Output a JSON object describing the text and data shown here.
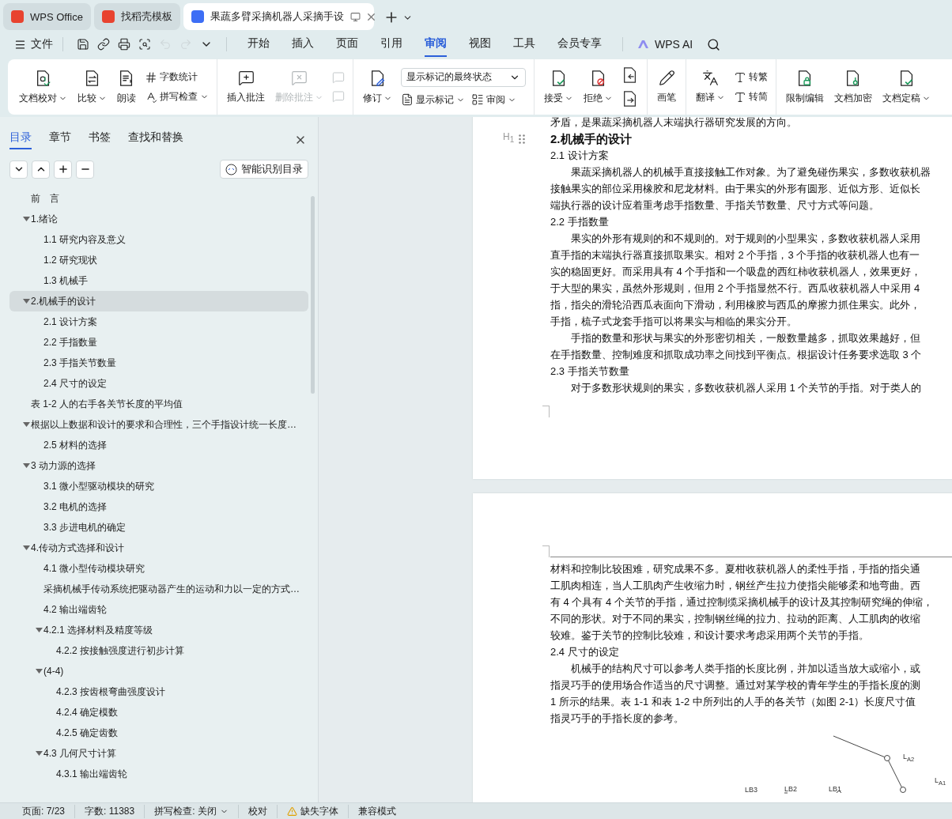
{
  "browser_tabs": [
    {
      "label": "WPS Office",
      "selected": false
    },
    {
      "label": "找稻壳模板",
      "selected": false
    },
    {
      "label": "果蔬多臂采摘机器人采摘手设",
      "selected": true
    }
  ],
  "menu": {
    "file": "文件",
    "quick_tools": [
      {
        "disabled": false
      },
      {
        "disabled": false
      },
      {
        "disabled": false
      },
      {
        "disabled": false
      },
      {
        "disabled": true
      },
      {
        "disabled": true
      }
    ],
    "tabs": [
      {
        "label": "开始",
        "selected": false
      },
      {
        "label": "插入",
        "selected": false
      },
      {
        "label": "页面",
        "selected": false
      },
      {
        "label": "引用",
        "selected": false
      },
      {
        "label": "审阅",
        "selected": true
      },
      {
        "label": "视图",
        "selected": false
      },
      {
        "label": "工具",
        "selected": false
      },
      {
        "label": "会员专享",
        "selected": false
      }
    ],
    "ai": "WPS AI"
  },
  "ribbon": {
    "groups": [
      {
        "columns": [
          {
            "rows": [
              [
                {
                  "kind": "large",
                  "label": "文档校对",
                  "menu": true,
                  "disabled": false
                }
              ]
            ]
          },
          {
            "rows": [
              [
                {
                  "kind": "large",
                  "label": "比较",
                  "menu": true,
                  "disabled": false
                }
              ]
            ]
          },
          {
            "rows": [
              [
                {
                  "kind": "large",
                  "label": "朗读",
                  "menu": false,
                  "disabled": false
                }
              ]
            ]
          },
          {
            "rows": [
              [
                {
                  "kind": "small",
                  "label": "字数统计",
                  "menu": false,
                  "disabled": false
                }
              ],
              [
                {
                  "kind": "small",
                  "label": "拼写检查",
                  "menu": true,
                  "disabled": false
                }
              ]
            ]
          }
        ]
      },
      {
        "columns": [
          {
            "rows": [
              [
                {
                  "kind": "large",
                  "label": "插入批注",
                  "menu": false,
                  "disabled": false
                }
              ]
            ]
          },
          {
            "rows": [
              [
                {
                  "kind": "large",
                  "label": "删除批注",
                  "menu": true,
                  "disabled": true
                }
              ]
            ]
          },
          {
            "rows": [
              [
                {
                  "kind": "icon",
                  "disabled": true
                }
              ],
              [
                {
                  "kind": "icon",
                  "disabled": true
                }
              ]
            ]
          }
        ]
      },
      {
        "columns": [
          {
            "rows": [
              [
                {
                  "kind": "large",
                  "label": "修订",
                  "menu": true,
                  "disabled": false
                }
              ]
            ]
          },
          {
            "rows": [
              [
                {
                  "kind": "select",
                  "label": "显示标记的最终状态",
                  "menu": true,
                  "disabled": false
                }
              ],
              [
                {
                  "kind": "small",
                  "label": "显示标记",
                  "menu": true,
                  "disabled": false
                },
                {
                  "kind": "small",
                  "label": "审阅",
                  "menu": true,
                  "disabled": false
                }
              ]
            ]
          }
        ]
      },
      {
        "columns": [
          {
            "rows": [
              [
                {
                  "kind": "large",
                  "label": "接受",
                  "menu": true,
                  "disabled": false
                }
              ]
            ]
          },
          {
            "rows": [
              [
                {
                  "kind": "large",
                  "label": "拒绝",
                  "menu": true,
                  "disabled": false
                }
              ]
            ]
          },
          {
            "rows": [
              [
                {
                  "kind": "icon",
                  "disabled": false
                }
              ],
              [
                {
                  "kind": "icon",
                  "disabled": false
                }
              ]
            ]
          }
        ]
      },
      {
        "columns": [
          {
            "rows": [
              [
                {
                  "kind": "large",
                  "label": "画笔",
                  "menu": false,
                  "disabled": false
                }
              ]
            ]
          }
        ]
      },
      {
        "columns": [
          {
            "rows": [
              [
                {
                  "kind": "large",
                  "label": "翻译",
                  "menu": true,
                  "disabled": false
                }
              ]
            ]
          },
          {
            "rows": [
              [
                {
                  "kind": "small",
                  "label": "转繁",
                  "menu": false,
                  "disabled": false
                }
              ],
              [
                {
                  "kind": "small",
                  "label": "转简",
                  "menu": false,
                  "disabled": false
                }
              ]
            ]
          }
        ]
      },
      {
        "columns": [
          {
            "rows": [
              [
                {
                  "kind": "large",
                  "label": "限制编辑",
                  "menu": false,
                  "disabled": false
                }
              ]
            ]
          },
          {
            "rows": [
              [
                {
                  "kind": "large",
                  "label": "文档加密",
                  "menu": false,
                  "disabled": false
                }
              ]
            ]
          },
          {
            "rows": [
              [
                {
                  "kind": "large",
                  "label": "文档定稿",
                  "menu": true,
                  "disabled": false
                }
              ]
            ]
          }
        ]
      }
    ]
  },
  "sidebar": {
    "tabs": [
      {
        "label": "目录",
        "selected": true
      },
      {
        "label": "章节",
        "selected": false
      },
      {
        "label": "书签",
        "selected": false
      },
      {
        "label": "查找和替换",
        "selected": false
      }
    ],
    "smart_toc": "智能识别目录",
    "outline": [
      {
        "label": "前　言",
        "selected": false
      },
      {
        "label": "1.绪论",
        "selected": false,
        "expanded": true,
        "children": [
          {
            "label": "1.1 研究内容及意义",
            "selected": false
          },
          {
            "label": "1.2 研究现状",
            "selected": false
          },
          {
            "label": "1.3 机械手",
            "selected": false
          }
        ]
      },
      {
        "label": "2.机械手的设计",
        "selected": true,
        "expanded": true,
        "children": [
          {
            "label": "2.1 设计方案",
            "selected": false
          },
          {
            "label": "2.2 手指数量",
            "selected": false
          },
          {
            "label": "2.3 手指关节数量",
            "selected": false
          },
          {
            "label": "2.4 尺寸的设定",
            "selected": false
          }
        ]
      },
      {
        "label": "表 1-2  人的右手各关节长度的平均值",
        "selected": false
      },
      {
        "label": "根据以上数据和设计的要求和合理性，三个手指设计统一长度…",
        "selected": false,
        "expanded": true,
        "children": [
          {
            "label": "2.5 材料的选择",
            "selected": false
          }
        ]
      },
      {
        "label": "3 动力源的选择",
        "selected": false,
        "expanded": true,
        "children": [
          {
            "label": "3.1 微小型驱动模块的研究",
            "selected": false
          },
          {
            "label": "3.2 电机的选择",
            "selected": false
          },
          {
            "label": "3.3 步进电机的确定",
            "selected": false
          }
        ]
      },
      {
        "label": "4.传动方式选择和设计",
        "selected": false,
        "expanded": true,
        "children": [
          {
            "label": "4.1 微小型传动模块研究",
            "selected": false
          },
          {
            "label": "采摘机械手传动系统把驱动器产生的运动和力以一定的方式…",
            "selected": false
          },
          {
            "label": "4.2 输出端齿轮",
            "selected": false
          },
          {
            "label": "4.2.1 选择材料及精度等级",
            "selected": false,
            "expanded": true,
            "children": [
              {
                "label": "4.2.2 按接触强度进行初步计算",
                "selected": false
              }
            ]
          },
          {
            "label": "(4-4)",
            "selected": false,
            "expanded": true,
            "children": [
              {
                "label": "4.2.3 按齿根弯曲强度设计",
                "selected": false
              },
              {
                "label": "4.2.4 确定模数",
                "selected": false
              },
              {
                "label": "4.2.5 确定齿数",
                "selected": false
              }
            ]
          },
          {
            "label": "4.3 几何尺寸计算",
            "selected": false,
            "expanded": true,
            "children": [
              {
                "label": "4.3.1 输出端齿轮",
                "selected": false
              }
            ]
          }
        ]
      }
    ]
  },
  "document": {
    "pages": [
      {
        "blocks": [
          {
            "kind": "para",
            "indent": false,
            "lines": [
              "矛盾，是果蔬采摘机器人末端执行器研究发展的方向。"
            ]
          },
          {
            "kind": "heading1",
            "marker": "H$_{1}$",
            "text": "2.机械手的设计"
          },
          {
            "kind": "heading2",
            "text": "2.1 设计方案"
          },
          {
            "kind": "para",
            "indent": true,
            "lines": [
              "果蔬采摘机器人的机械手直接接触工作对象。为了避免碰伤果实，多数收获机器",
              "接触果实的部位采用橡胶和尼龙材料。由于果实的外形有圆形、近似方形、近似长",
              "端执行器的设计应着重考虑手指数量、手指关节数量、尺寸方式等问题。"
            ]
          },
          {
            "kind": "heading2",
            "text": "2.2 手指数量"
          },
          {
            "kind": "para",
            "indent": true,
            "lines": [
              "果实的外形有规则的和不规则的。对于规则的小型果实，多数收获机器人采用",
              "直手指的末端执行器直接抓取果实。相对 2 个手指，3 个手指的收获机器人也有一",
              "实的稳固更好。而采用具有 4 个手指和一个吸盘的西红柿收获机器人，效果更好，",
              "于大型的果实，虽然外形规则，但用 2 个手指显然不行。西瓜收获机器人中采用 4",
              "指，指尖的滑轮沿西瓜表面向下滑动，利用橡胶与西瓜的摩擦力抓住果实。此外，",
              "手指，梳子式龙套手指可以将果实与相临的果实分开。"
            ]
          },
          {
            "kind": "para",
            "indent": true,
            "lines": [
              "手指的数量和形状与果实的外形密切相关，一般数量越多，抓取效果越好，但",
              "在手指数量、控制难度和抓取成功率之间找到平衡点。根据设计任务要求选取 3 个"
            ]
          },
          {
            "kind": "heading2",
            "text": "2.3 手指关节数量"
          },
          {
            "kind": "para",
            "indent": true,
            "lines": [
              "对于多数形状规则的果实，多数收获机器人采用 1 个关节的手指。对于类人的"
            ]
          }
        ]
      },
      {
        "blocks": [
          {
            "kind": "para",
            "indent": false,
            "lines": [
              "材料和控制比较困难，研究成果不多。夏柑收获机器人的柔性手指，手指的指尖通",
              "工肌肉相连，当人工肌肉产生收缩力时，钢丝产生拉力使指尖能够柔和地弯曲。西",
              "有 4 个具有 4 个关节的手指，通过控制缆采摘机械手的设计及其控制研究绳的伸缩，",
              "不同的形状。对于不同的果实，控制钢丝绳的拉力、拉动的距离、人工肌肉的收缩",
              "较难。鉴于关节的控制比较难，和设计要求考虑采用两个关节的手指。"
            ]
          },
          {
            "kind": "heading2",
            "text": "2.4 尺寸的设定"
          },
          {
            "kind": "para",
            "indent": true,
            "lines": [
              "机械手的结构尺寸可以参考人类手指的长度比例，并加以适当放大或缩小，或",
              "指灵巧手的使用场合作适当的尺寸调整。通过对某学校的青年学生的手指长度的测",
              "1 所示的结果。表 1-1 和表 1-2 中所列出的人手的各关节（如图 2-1）长度尺寸值",
              "指灵巧手的手指长度的参考。"
            ]
          },
          {
            "kind": "figure",
            "labels": [
              "L$_{A2}$",
              "L$_{A1}$",
              "LB3",
              "LB2",
              "LB1"
            ]
          }
        ]
      }
    ]
  },
  "status_bar": [
    {
      "kind": "text",
      "label": "页面: 7/23"
    },
    {
      "kind": "text",
      "label": "字数: 11383"
    },
    {
      "kind": "dropdown",
      "label": "拼写检查: 关闭"
    },
    {
      "kind": "text",
      "label": "校对"
    },
    {
      "kind": "warning",
      "label": "缺失字体"
    },
    {
      "kind": "text",
      "label": "兼容模式"
    }
  ]
}
